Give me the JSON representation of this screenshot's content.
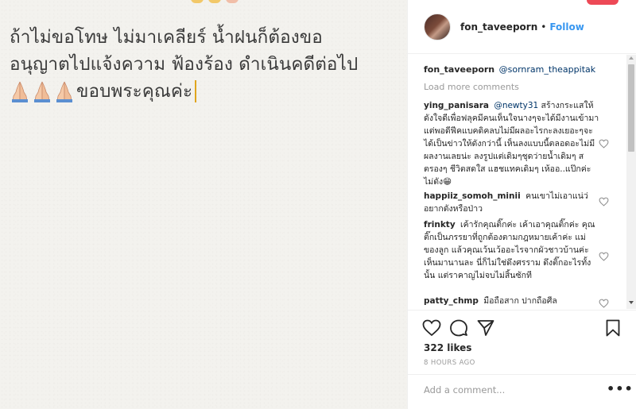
{
  "post": {
    "caption_lines": [
      "ถ้าไม่ขอโทษ ไม่มาเคลียร์ น้ำฝนก็ต้องขอ",
      "อนุญาตไปแจ้งความ ฟ้องร้อง ดำเนินคดีต่อไป",
      "ขอบพระคุณค่ะ"
    ],
    "pray_emoji_count": 3
  },
  "header": {
    "username": "fon_taveeporn",
    "dot": "•",
    "follow_label": "Follow"
  },
  "caption": {
    "username": "fon_taveeporn",
    "mention": "@sornram_theappitak"
  },
  "load_more_label": "Load more comments",
  "comments": [
    {
      "username": "ying_panisara",
      "mention": "@newty31",
      "text": " สร้างกระแสให้ดังใจดีเพื่อฟลุคมีคนเห็นใจนางๆจะได้มีงานเข้ามา แต่พอดีฟีคแบคดิคลบไม่มีผลอะไรกะลงเยอะๆจะได้เป็นข่าวให้ดังกว่านี้ เห็นลงแบบนี้ตลอดอะไม่มีผลงานเลยน่ะ ลงรูปแต่เดิมๆชุดว่ายน้ำเดิมๆ สตรองๆ ชีวิตสดใส แฮชแทคเดิมๆ เห้ออ..แป๊กค่ะไม่ดัง😁"
    },
    {
      "username": "happiiz_somoh_minii",
      "mention": "",
      "text": "คนเขาไม่เอาแน่ว่อยากดังหรือป่าว"
    },
    {
      "username": "frinkty",
      "mention": "",
      "text": "เค้ารักคุณติ๊กค่ะ เค้าเอาคุณติ๊กค่ะ คุณติ๊กเป็นภรรยาที่ถูกต้องตามกฎหมายเค้าค่ะ แม่ของลูก แล้วคุณเว้นเว้ออะไรจากผัวชาวบ้านค่ะ เห็นมานานละ นี่ก็ไม่ใช่ดึงศรราม ดึงติ๊กอะไรทั้งนั้น แต่ราคาญไม่จบไม่สิ้นซักที"
    },
    {
      "username": "patty_chmp",
      "mention": "",
      "text": "มือถือสาก ปากถือศีล"
    }
  ],
  "actions": {
    "likes": "322 likes",
    "time_ago": "8 HOURS AGO"
  },
  "comment_box": {
    "placeholder": "Add a comment...",
    "more_label": "•••"
  },
  "icons": {
    "like": "heart-icon",
    "comment": "comment-bubble-icon",
    "share": "share-icon",
    "save": "bookmark-icon",
    "comment_like": "heart-icon",
    "pray": "folded-hands-icon"
  },
  "colors": {
    "follow_blue": "#3897f0",
    "mention_blue": "#003569",
    "muted_gray": "#999999",
    "text_dark": "#262626",
    "cursor_gold": "#e0a51e"
  }
}
